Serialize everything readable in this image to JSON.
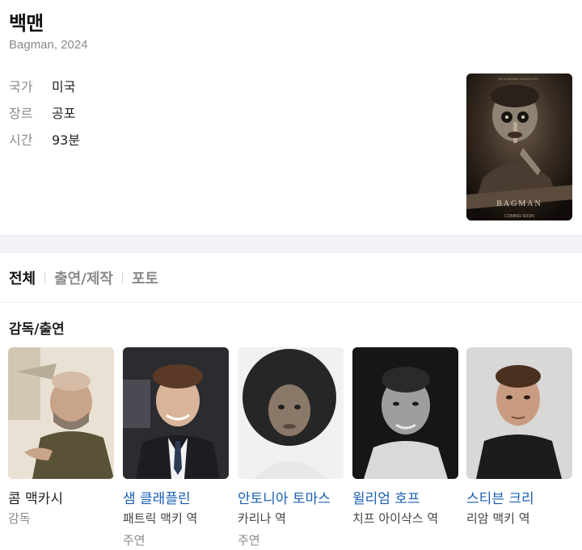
{
  "movie": {
    "title": "백맨",
    "subtitle": "Bagman, 2024",
    "details": [
      {
        "key": "국가",
        "value": "미국"
      },
      {
        "key": "장르",
        "value": "공포"
      },
      {
        "key": "시간",
        "value": "93분"
      }
    ],
    "poster": {
      "tagline": "ON A SATANIC BLACK DAY...",
      "title": "BAGMAN",
      "footer": "COMING SOON"
    }
  },
  "tabs": [
    {
      "label": "전체",
      "active": true
    },
    {
      "label": "출연/제작",
      "active": false
    },
    {
      "label": "포토",
      "active": false
    }
  ],
  "section": {
    "title": "감독/출연"
  },
  "cast": [
    {
      "name": "콤 맥카시",
      "role": "감독",
      "sub": "",
      "link": false
    },
    {
      "name": "샘 클래플린",
      "role": "패트릭 맥키 역",
      "sub": "주연",
      "link": true
    },
    {
      "name": "안토니아 토마스",
      "role": "카리나 역",
      "sub": "주연",
      "link": true
    },
    {
      "name": "윌리엄 호프",
      "role": "치프 아이삭스 역",
      "sub": "",
      "link": true
    },
    {
      "name": "스티븐 크리",
      "role": "리암 맥키 역",
      "sub": "",
      "link": true
    }
  ]
}
